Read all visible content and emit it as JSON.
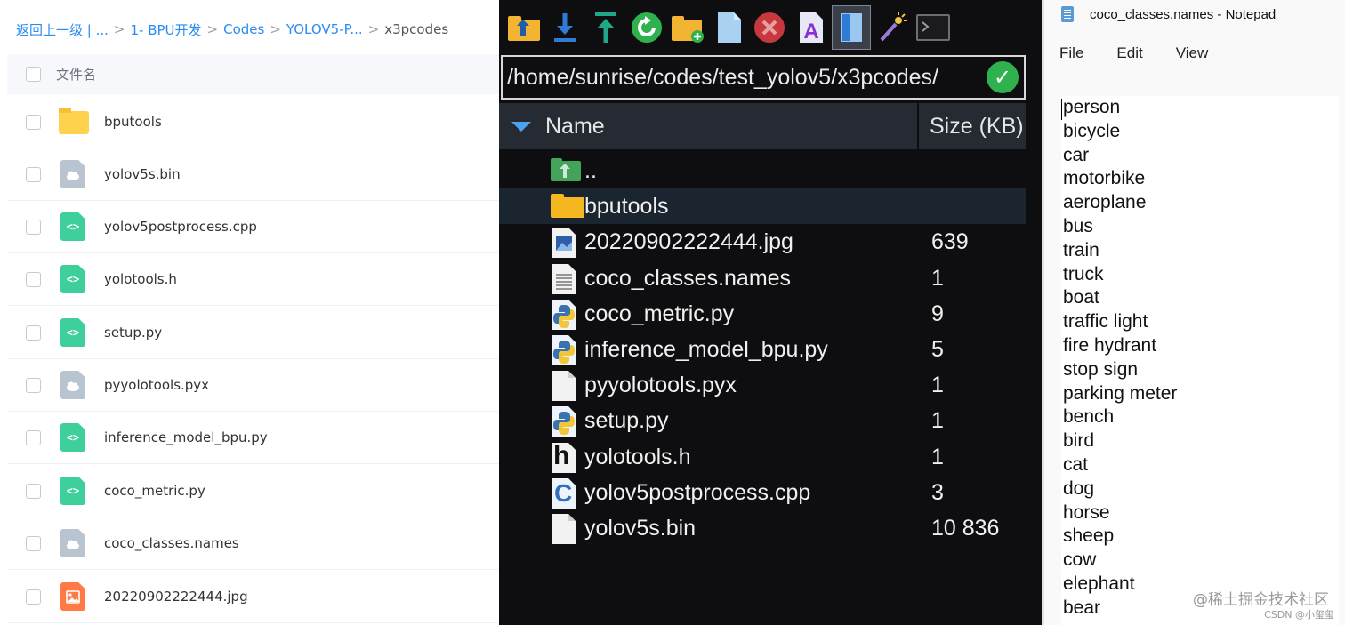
{
  "left_panel": {
    "breadcrumb": [
      {
        "label": "返回上一级 | ...",
        "current": false
      },
      {
        "label": "1- BPU开发",
        "current": false
      },
      {
        "label": "Codes",
        "current": false
      },
      {
        "label": "YOLOV5-P...",
        "current": false
      },
      {
        "label": "x3pcodes",
        "current": true
      }
    ],
    "breadcrumb_sep": ">",
    "header_label": "文件名",
    "files": [
      {
        "name": "bputools",
        "icon": "folder-icon"
      },
      {
        "name": "yolov5s.bin",
        "icon": "cloud-file-icon"
      },
      {
        "name": "yolov5postprocess.cpp",
        "icon": "code-file-icon"
      },
      {
        "name": "yolotools.h",
        "icon": "code-file-icon"
      },
      {
        "name": "setup.py",
        "icon": "code-file-icon"
      },
      {
        "name": "pyyolotools.pyx",
        "icon": "cloud-file-icon"
      },
      {
        "name": "inference_model_bpu.py",
        "icon": "code-file-icon"
      },
      {
        "name": "coco_metric.py",
        "icon": "code-file-icon"
      },
      {
        "name": "coco_classes.names",
        "icon": "cloud-file-icon"
      },
      {
        "name": "20220902222444.jpg",
        "icon": "image-file-icon"
      }
    ],
    "code_glyph": "<>",
    "colors": {
      "link": "#2a8cf0",
      "folder": "#ffd24d",
      "code": "#3ecf9b",
      "cloud": "#b9c4d1",
      "image": "#ff7a45"
    }
  },
  "middle_panel": {
    "toolbar": [
      {
        "icon": "parent-folder-icon"
      },
      {
        "icon": "download-icon"
      },
      {
        "icon": "upload-icon"
      },
      {
        "icon": "refresh-icon"
      },
      {
        "icon": "new-folder-icon"
      },
      {
        "icon": "new-file-icon"
      },
      {
        "icon": "delete-icon"
      },
      {
        "icon": "rename-icon"
      },
      {
        "icon": "panel-view-icon"
      },
      {
        "icon": "magic-wand-icon"
      },
      {
        "icon": "terminal-icon"
      }
    ],
    "path": "/home/sunrise/codes/test_yolov5/x3pcodes/",
    "path_ok": "✓",
    "col_name": "Name",
    "col_size": "Size (KB)",
    "files": [
      {
        "name": "..",
        "size": "",
        "icon": "parent-folder-icon"
      },
      {
        "name": "bputools",
        "size": "",
        "icon": "folder-icon"
      },
      {
        "name": "20220902222444.jpg",
        "size": "639",
        "icon": "image-file-icon"
      },
      {
        "name": "coco_classes.names",
        "size": "1",
        "icon": "text-file-icon"
      },
      {
        "name": "coco_metric.py",
        "size": "9",
        "icon": "python-file-icon"
      },
      {
        "name": "inference_model_bpu.py",
        "size": "5",
        "icon": "python-file-icon"
      },
      {
        "name": "pyyolotools.pyx",
        "size": "1",
        "icon": "blank-file-icon"
      },
      {
        "name": "setup.py",
        "size": "1",
        "icon": "python-file-icon"
      },
      {
        "name": "yolotools.h",
        "size": "1",
        "icon": "header-file-icon"
      },
      {
        "name": "yolov5postprocess.cpp",
        "size": "3",
        "icon": "cpp-file-icon"
      },
      {
        "name": "yolov5s.bin",
        "size": "10 836",
        "icon": "blank-file-icon"
      }
    ],
    "selected_index": 1,
    "header_glyph": "h",
    "cpp_glyph": "C"
  },
  "notepad": {
    "title": "coco_classes.names - Notepad",
    "menu": [
      "File",
      "Edit",
      "View"
    ],
    "lines": [
      "person",
      "bicycle",
      "car",
      "motorbike",
      "aeroplane",
      "bus",
      "train",
      "truck",
      "boat",
      "traffic light",
      "fire hydrant",
      "stop sign",
      "parking meter",
      "bench",
      "bird",
      "cat",
      "dog",
      "horse",
      "sheep",
      "cow",
      "elephant",
      "bear"
    ]
  },
  "watermark": {
    "line1": "@稀土掘金技术社区",
    "line2": "CSDN @小玺玺"
  }
}
